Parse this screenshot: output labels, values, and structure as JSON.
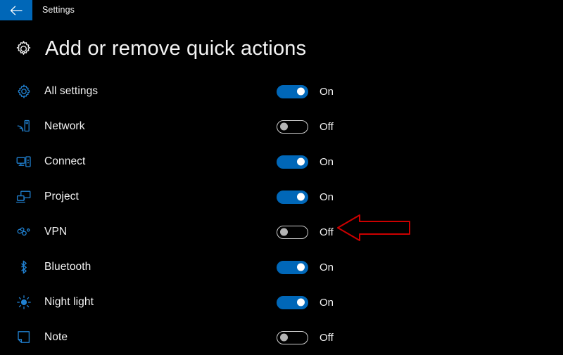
{
  "titlebar": {
    "back_label": "back-arrow",
    "app_name": "Settings"
  },
  "heading": {
    "icon": "gear-icon",
    "title": "Add or remove quick actions"
  },
  "colors": {
    "background": "#000000",
    "accent_blue": "#0067b8",
    "icon_blue": "#1f7fd4",
    "text": "#f2f2f2",
    "toggle_off_border": "#cfcfcf",
    "toggle_off_knob": "#b4b4b4",
    "annotation_red": "#cc0000"
  },
  "quick_actions": [
    {
      "icon": "gear-icon",
      "label": "All settings",
      "state": "On",
      "on": true
    },
    {
      "icon": "network-icon",
      "label": "Network",
      "state": "Off",
      "on": false
    },
    {
      "icon": "connect-icon",
      "label": "Connect",
      "state": "On",
      "on": true
    },
    {
      "icon": "project-icon",
      "label": "Project",
      "state": "On",
      "on": true
    },
    {
      "icon": "vpn-icon",
      "label": "VPN",
      "state": "Off",
      "on": false
    },
    {
      "icon": "bluetooth-icon",
      "label": "Bluetooth",
      "state": "On",
      "on": true
    },
    {
      "icon": "night-light-icon",
      "label": "Night light",
      "state": "On",
      "on": true
    },
    {
      "icon": "note-icon",
      "label": "Note",
      "state": "Off",
      "on": false
    }
  ],
  "annotation": {
    "type": "arrow-left",
    "points_at": "VPN"
  }
}
